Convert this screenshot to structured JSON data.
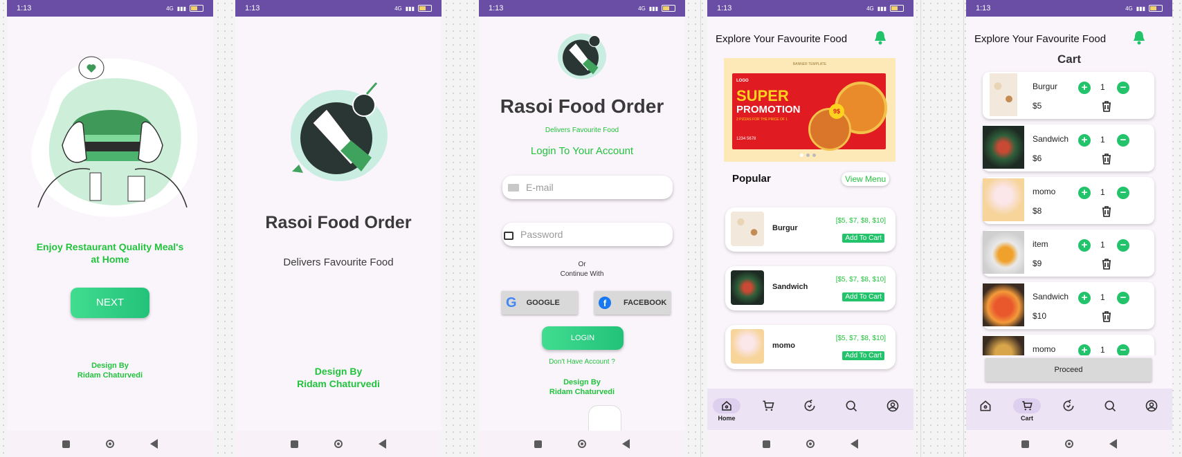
{
  "status": {
    "time": "1:13",
    "dots": "···"
  },
  "screen1": {
    "tagline_line1": "Enjoy Restaurant Quality Meal's",
    "tagline_line2": "at Home",
    "next_label": "NEXT",
    "design_by": "Design By",
    "designer": "Ridam Chaturvedi"
  },
  "screen2": {
    "title": "Rasoi Food Order",
    "subtitle": "Delivers Favourite Food",
    "design_by": "Design By",
    "designer": "Ridam Chaturvedi"
  },
  "screen3": {
    "title": "Rasoi Food Order",
    "subtitle": "Delivers Favourite Food",
    "login_heading": "Login To Your Account",
    "email_placeholder": "E-mail",
    "password_placeholder": "Password",
    "or": "Or",
    "continue_with": "Continue With",
    "google": "GOOGLE",
    "facebook": "FACEBOOK",
    "login_label": "LOGIN",
    "no_account": "Don't  Have Account ?",
    "design_by": "Design By",
    "designer": "Ridam Chaturvedi"
  },
  "screen4": {
    "header": "Explore Your Favourite Food",
    "banner": {
      "template": "BANNER TEMPLATE",
      "logo": "LOGO",
      "super": "SUPER",
      "promotion": "PROMOTION",
      "offer": "2 PIZZAS FOR THE PRICE OF 1",
      "phone": "1234 5678",
      "price": "9$"
    },
    "popular": "Popular",
    "view_menu": "View Menu",
    "items": [
      {
        "name": "Burgur",
        "prices": "[$5, $7, $8, $10]",
        "add": "Add To Cart"
      },
      {
        "name": "Sandwich",
        "prices": "[$5, $7, $8, $10]",
        "add": "Add To Cart"
      },
      {
        "name": "momo",
        "prices": "[$5, $7, $8, $10]",
        "add": "Add To Cart"
      }
    ],
    "tab_home": "Home"
  },
  "screen5": {
    "header": "Explore Your Favourite Food",
    "title": "Cart",
    "items": [
      {
        "name": "Burgur",
        "qty": "1",
        "price": "$5"
      },
      {
        "name": "Sandwich",
        "qty": "1",
        "price": "$6"
      },
      {
        "name": "momo",
        "qty": "1",
        "price": "$8"
      },
      {
        "name": "item",
        "qty": "1",
        "price": "$9"
      },
      {
        "name": "Sandwich",
        "qty": "1",
        "price": "$10"
      },
      {
        "name": "momo",
        "qty": "1",
        "price": ""
      }
    ],
    "proceed": "Proceed",
    "tab_cart": "Cart"
  }
}
